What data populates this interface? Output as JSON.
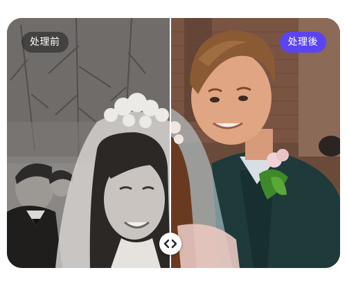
{
  "compare": {
    "before_label": "处理前",
    "after_label": "处理後",
    "before_image": "wedding-photo-original-grayscale",
    "after_image": "wedding-photo-colorized",
    "handle_icon": "left-right-arrows-icon",
    "split_position": 0.49,
    "accent_color": "#5b44f2"
  }
}
